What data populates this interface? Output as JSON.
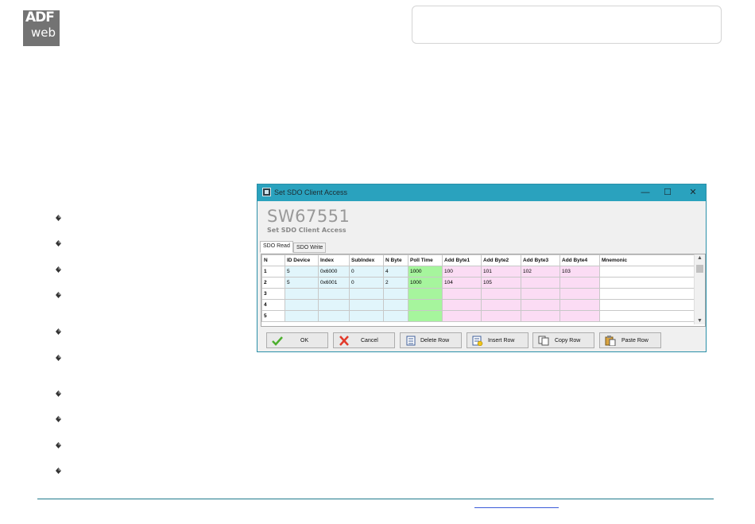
{
  "logo": {
    "line1": "ADF",
    "line2": "web"
  },
  "window": {
    "title": "Set SDO Client Access",
    "product": "SW67551",
    "subtitle": "Set SDO Client Access",
    "controls": {
      "minimize": "—",
      "maximize": "☐",
      "close": "✕"
    },
    "tabs": [
      {
        "label": "SDO Read"
      },
      {
        "label": "SDO Write"
      }
    ],
    "grid": {
      "headers": [
        "N",
        "ID Device",
        "Index",
        "SubIndex",
        "N Byte",
        "Poll Time",
        "Add Byte1",
        "Add Byte2",
        "Add Byte3",
        "Add Byte4",
        "Mnemonic"
      ],
      "rows": [
        [
          "1",
          "5",
          "0x6000",
          "0",
          "4",
          "1000",
          "100",
          "101",
          "102",
          "103",
          ""
        ],
        [
          "2",
          "5",
          "0x6001",
          "0",
          "2",
          "1000",
          "104",
          "105",
          "",
          "",
          ""
        ],
        [
          "3",
          "",
          "",
          "",
          "",
          "",
          "",
          "",
          "",
          "",
          ""
        ],
        [
          "4",
          "",
          "",
          "",
          "",
          "",
          "",
          "",
          "",
          "",
          ""
        ],
        [
          "5",
          "",
          "",
          "",
          "",
          "",
          "",
          "",
          "",
          "",
          ""
        ]
      ]
    },
    "buttons": {
      "ok": "OK",
      "cancel": "Cancel",
      "delete_row": "Delete Row",
      "insert_row": "Insert Row",
      "copy_row": "Copy Row",
      "paste_row": "Paste Row"
    }
  }
}
